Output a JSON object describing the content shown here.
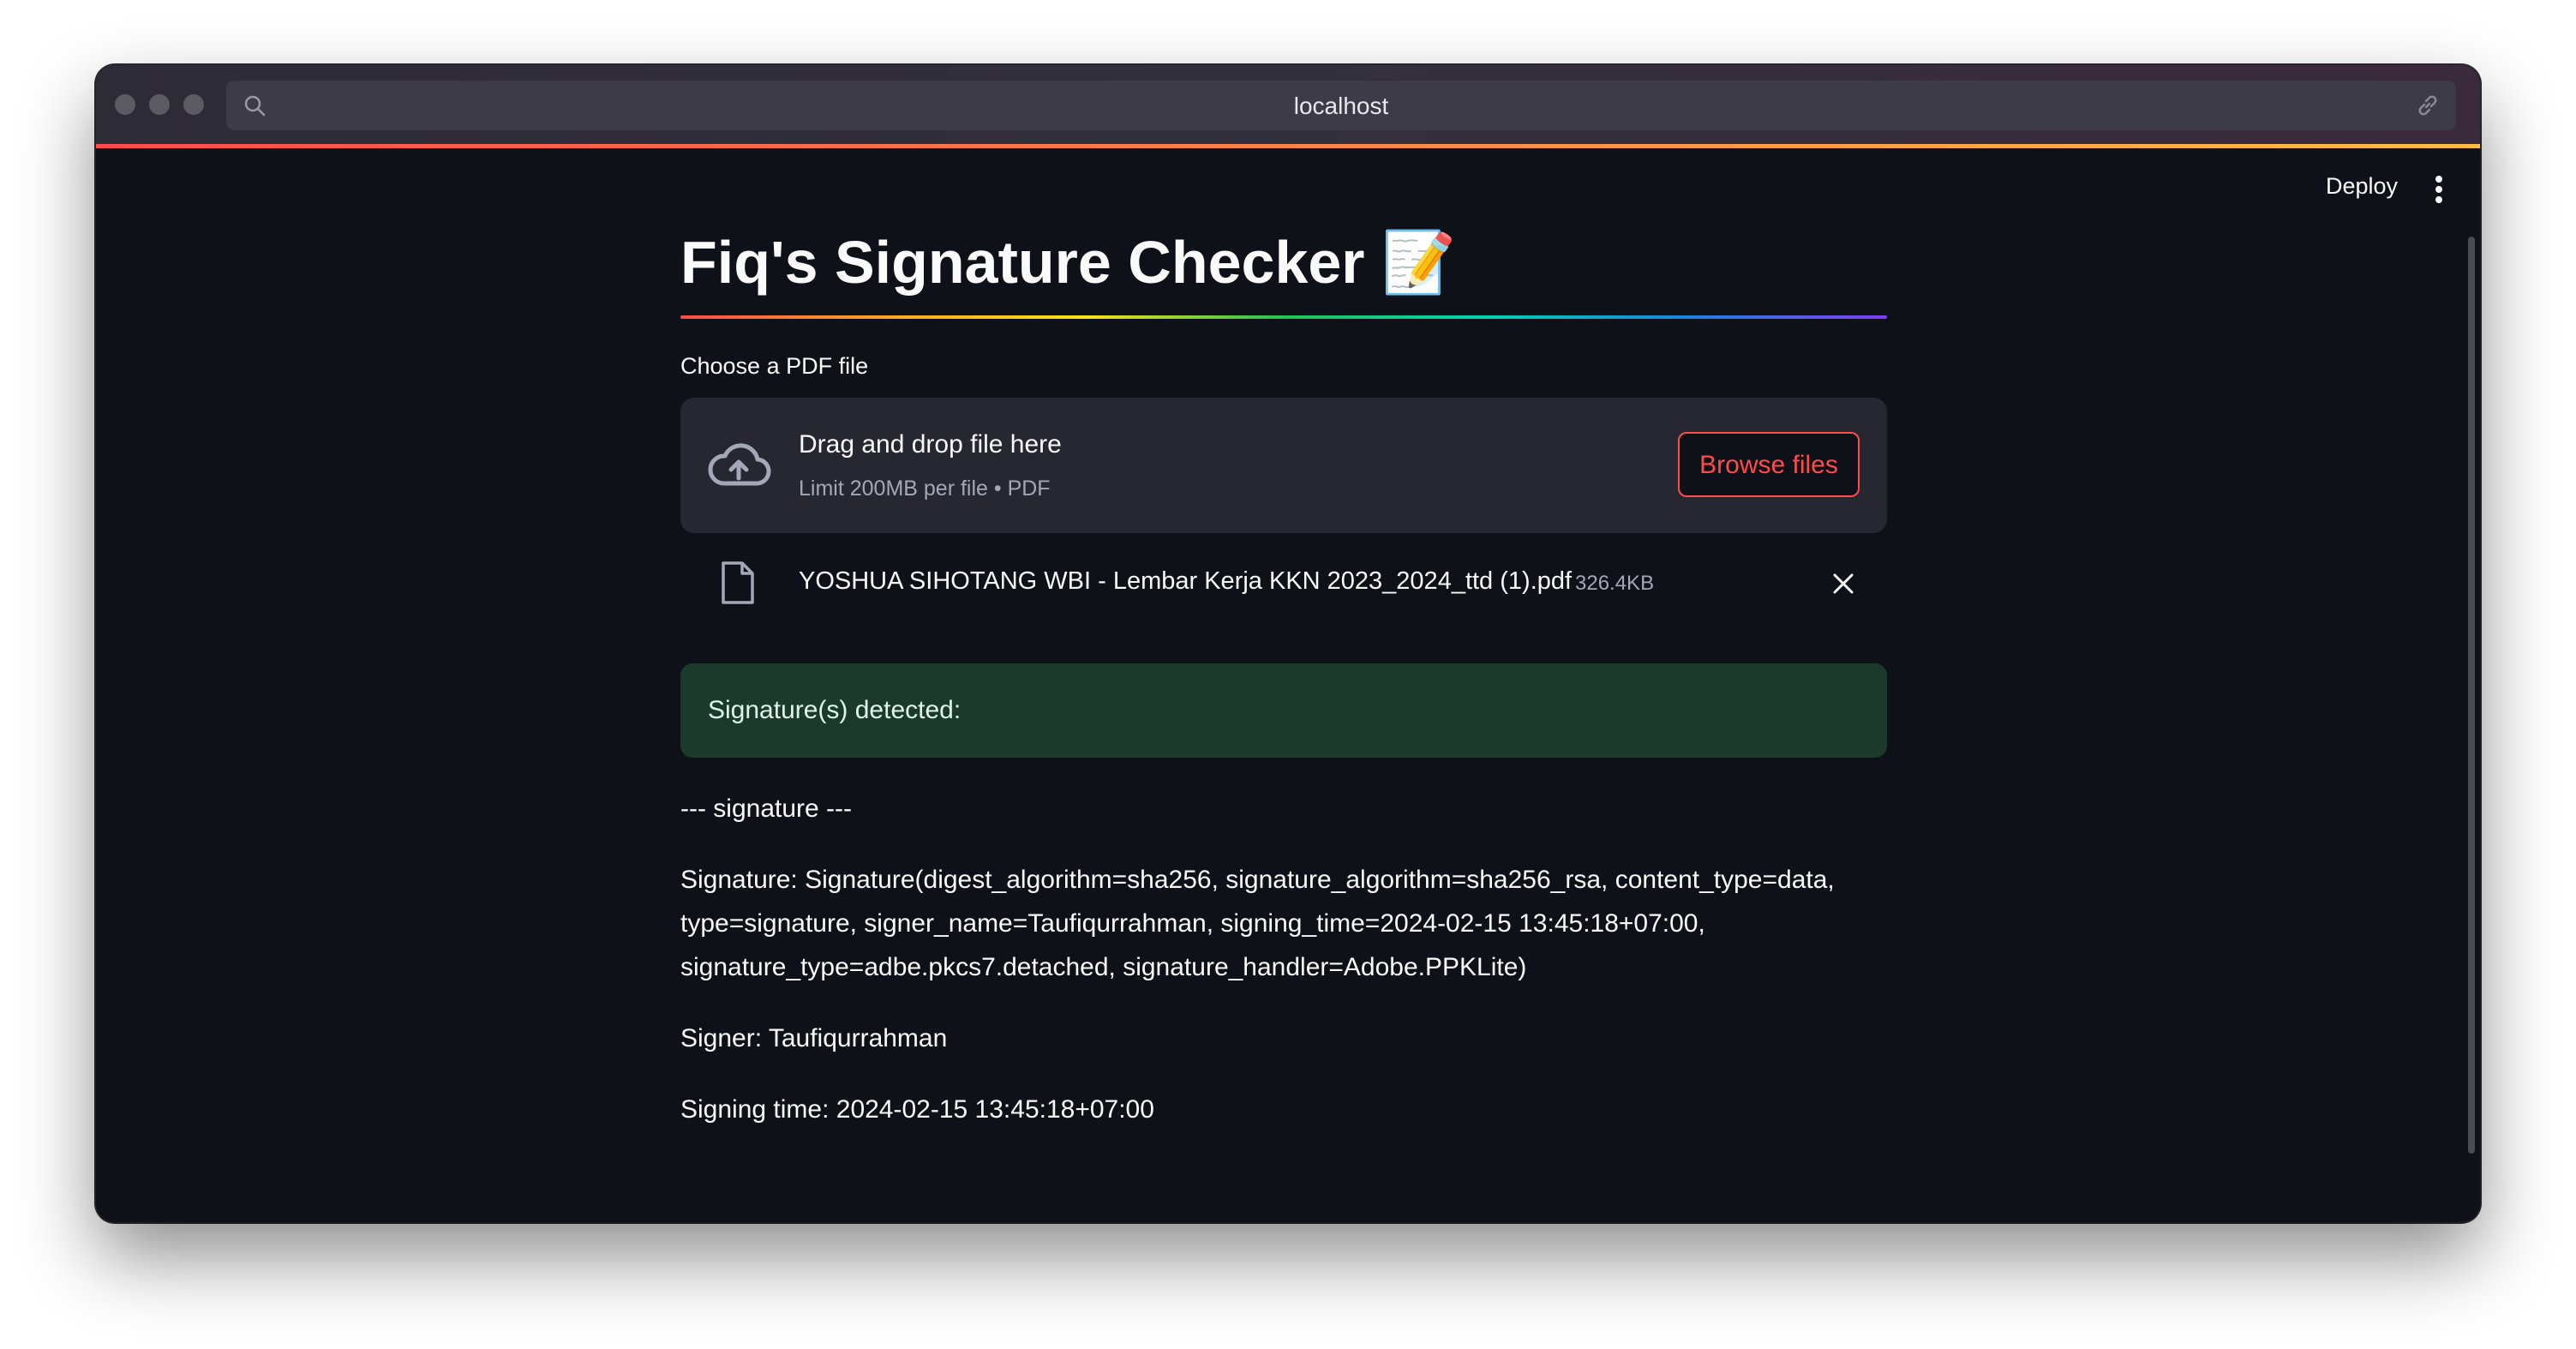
{
  "browser": {
    "url": "localhost"
  },
  "toolbar": {
    "deploy_label": "Deploy"
  },
  "app": {
    "title": "Fiq's Signature Checker 📝"
  },
  "uploader": {
    "label": "Choose a PDF file",
    "drag_text": "Drag and drop file here",
    "limit_text": "Limit 200MB per file • PDF",
    "browse_label": "Browse files",
    "icon": "cloud-upload-icon"
  },
  "uploaded_file": {
    "name": "YOSHUA SIHOTANG WBI - Lembar Kerja KKN 2023_2024_ttd (1).pdf",
    "size": "326.4KB",
    "icon": "file-icon"
  },
  "result": {
    "success_message": "Signature(s) detected:",
    "section_header": "--- signature ---",
    "signature_line": "Signature: Signature(digest_algorithm=sha256, signature_algorithm=sha256_rsa, content_type=data, type=signature, signer_name=Taufiqurrahman, signing_time=2024-02-15 13:45:18+07:00, signature_type=adbe.pkcs7.detached, signature_handler=Adobe.PPKLite)",
    "signer_line": "Signer: Taufiqurrahman",
    "time_line": "Signing time: 2024-02-15 13:45:18+07:00"
  },
  "colors": {
    "background": "#0e1117",
    "accent": "#ff4b4b",
    "success_bg": "#1b3a2b",
    "panel": "#262730"
  }
}
